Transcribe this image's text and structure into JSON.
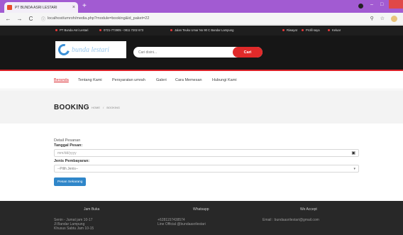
{
  "browser": {
    "tab_title": "PT BUNDA ASRI LESTARI",
    "url": "localhost/umroh/media.php?module=booking&id_paket=22"
  },
  "infobar": {
    "company": "PT Bunda Asri Lestari",
    "phones": "0721-773905 - 0811 7202 673",
    "address": "Jalan Teuku Umar No 90 C Bandar Lampung",
    "riwayat": "Riwayat",
    "profil": "Profil saya",
    "keluar": "Keluar"
  },
  "header": {
    "logo_text": "bunda lestari",
    "search_placeholder": "Cari disini...",
    "search_button": "Cari"
  },
  "menu": {
    "items": [
      "Beranda",
      "Tentang Kami",
      "Persyaratan umrah",
      "Galeri",
      "Cara Memesan",
      "Hubungi Kami"
    ]
  },
  "page": {
    "title": "BOOKING",
    "breadcrumb_home": "HOME",
    "breadcrumb_sep": "/",
    "breadcrumb_current": "BOOKING"
  },
  "form": {
    "section_label": "Detail Pesanan",
    "date_label": "Tanggal Pesan:",
    "date_placeholder": "mm/dd/yyyy",
    "payment_label": "Jenis Pembayaran:",
    "payment_selected": "--Pilih Jenis--",
    "submit_label": "Pesan Sekarang"
  },
  "footer": {
    "col1_title": "Jam Buka",
    "col1_lines": [
      "Senin - Jumat jam 10-17",
      "Jl Bandar Lampung",
      "Khusus Sabtu Jam 10-15"
    ],
    "col2_title": "Whatsapp",
    "col2_lines": [
      "+6281157438574",
      "Line Official @bundaasrilestari"
    ],
    "col3_title": "We Accept",
    "col3_lines": [
      "Email : bundaasrilestari@gmail.com"
    ]
  },
  "colors": {
    "accent_red": "#d92027",
    "tab_bar": "#a25bd2",
    "button_blue": "#2f86c9"
  }
}
